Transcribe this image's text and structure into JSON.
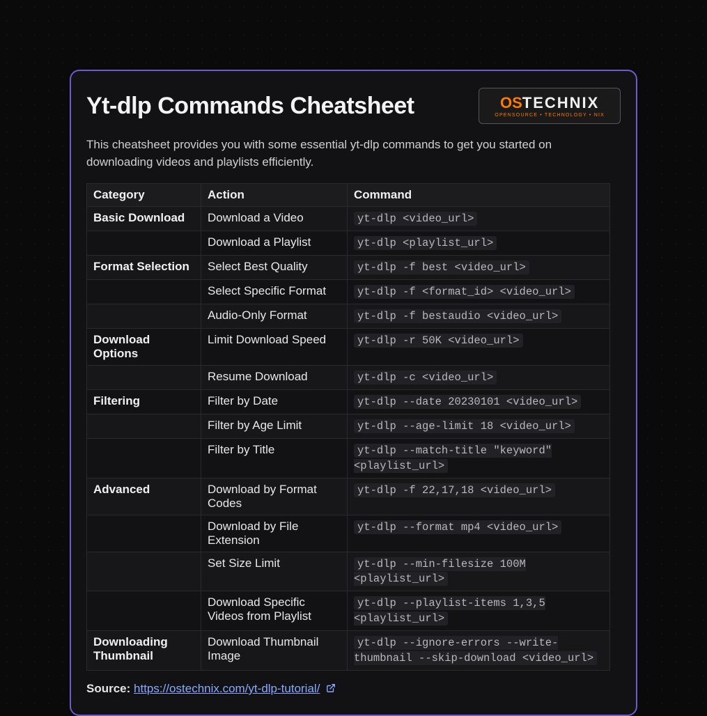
{
  "title": "Yt-dlp Commands Cheatsheet",
  "logo": {
    "part1": "OS",
    "part2": "TECHNIX",
    "tagline": "OPENSOURCE • TECHNOLOGY • NIX"
  },
  "intro": "This cheatsheet provides you with some essential yt-dlp commands to get you started on downloading videos and playlists efficiently.",
  "columns": {
    "c0": "Category",
    "c1": "Action",
    "c2": "Command"
  },
  "rows": [
    {
      "cat": "Basic Download",
      "act": "Download a Video",
      "cmd": "yt-dlp <video_url>"
    },
    {
      "cat": "",
      "act": "Download a Playlist",
      "cmd": "yt-dlp <playlist_url>"
    },
    {
      "cat": "Format Selection",
      "act": "Select Best Quality",
      "cmd": "yt-dlp -f best <video_url>"
    },
    {
      "cat": "",
      "act": "Select Specific Format",
      "cmd": "yt-dlp -f <format_id> <video_url>"
    },
    {
      "cat": "",
      "act": "Audio-Only Format",
      "cmd": "yt-dlp -f bestaudio <video_url>"
    },
    {
      "cat": "Download Options",
      "act": "Limit Download Speed",
      "cmd": "yt-dlp -r 50K <video_url>"
    },
    {
      "cat": "",
      "act": "Resume Download",
      "cmd": "yt-dlp -c <video_url>"
    },
    {
      "cat": "Filtering",
      "act": "Filter by Date",
      "cmd": "yt-dlp --date 20230101 <video_url>"
    },
    {
      "cat": "",
      "act": "Filter by Age Limit",
      "cmd": "yt-dlp --age-limit 18 <video_url>"
    },
    {
      "cat": "",
      "act": "Filter by Title",
      "cmd": "yt-dlp --match-title \"keyword\" <playlist_url>"
    },
    {
      "cat": "Advanced",
      "act": "Download by Format Codes",
      "cmd": "yt-dlp -f 22,17,18 <video_url>"
    },
    {
      "cat": "",
      "act": "Download by File Extension",
      "cmd": "yt-dlp --format mp4 <video_url>"
    },
    {
      "cat": "",
      "act": "Set Size Limit",
      "cmd": "yt-dlp --min-filesize 100M <playlist_url>"
    },
    {
      "cat": "",
      "act": "Download Specific Videos from Playlist",
      "cmd": "yt-dlp --playlist-items 1,3,5 <playlist_url>"
    },
    {
      "cat": "Downloading Thumbnail",
      "act": "Download Thumbnail Image",
      "cmd": "yt-dlp --ignore-errors --write-thumbnail --skip-download <video_url>"
    }
  ],
  "source": {
    "label": "Source: ",
    "url_text": "https://ostechnix.com/yt-dlp-tutorial/",
    "url": "https://ostechnix.com/yt-dlp-tutorial/"
  }
}
